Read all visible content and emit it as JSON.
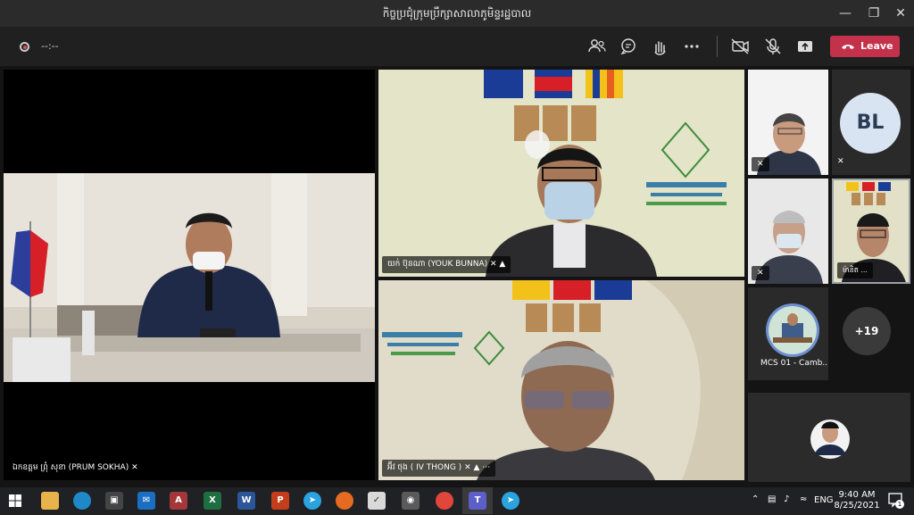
{
  "window": {
    "title": "កិច្ចប្រជុំក្រុមប្រឹក្សាសាលាភូមិន្ទរដ្ឋបាល"
  },
  "callbar": {
    "timer": "--:--",
    "leave_label": "Leave"
  },
  "tiles": {
    "prum_sokha": "ឯកឧត្តម ព្រុំ សុខា (PRUM SOKHA)",
    "youk_bunna": "យក់ ប៊ុនណា (YOUK BUNNA)",
    "iv_thong": "អ៊ីវ ថុង ( IV THONG )",
    "small4": "ម៉ានិត ...",
    "mcs": "MCS 01 - Camb...",
    "bl_initials": "BL",
    "overflow_count": "+19"
  },
  "taskbar": {
    "language": "ENG",
    "time": "9:40 AM",
    "date": "8/25/2021",
    "notification_count": "1"
  },
  "colors": {
    "leave": "#c4314b",
    "titlebar": "#2b2b2b"
  }
}
